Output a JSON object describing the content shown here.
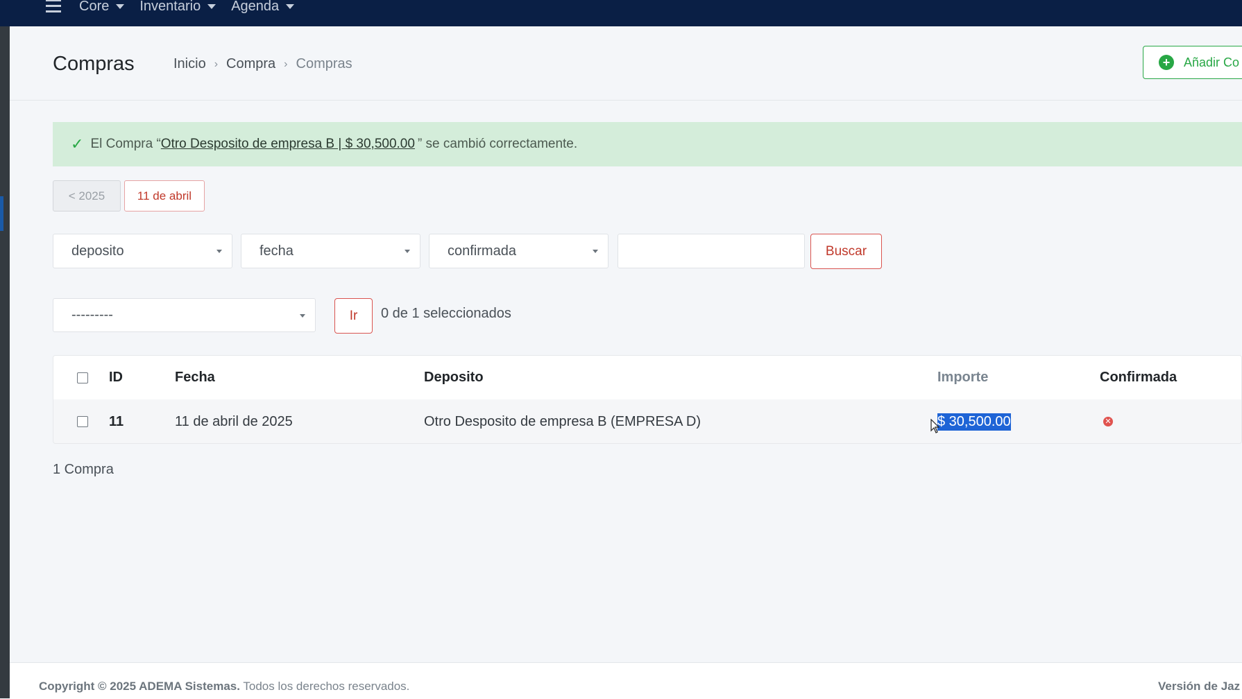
{
  "nav": {
    "items": [
      {
        "label": "Core"
      },
      {
        "label": "Inventario"
      },
      {
        "label": "Agenda"
      }
    ]
  },
  "header": {
    "title": "Compras",
    "breadcrumb": [
      "Inicio",
      "Compra",
      "Compras"
    ],
    "add_button_label": "Añadir Co"
  },
  "alert": {
    "prefix": "El Compra “",
    "link_text": "Otro Desposito de empresa B | $ 30,500.00",
    "suffix": "” se cambió correctamente."
  },
  "date_nav": {
    "prev_label": "< 2025",
    "current_label": "11 de abril"
  },
  "filters": {
    "deposito": "deposito",
    "fecha": "fecha",
    "confirmada": "confirmada",
    "search_value": "",
    "search_button": "Buscar"
  },
  "actions": {
    "selected_action": "---------",
    "go_button": "Ir",
    "selected_count": "0 de 1 seleccionados"
  },
  "table": {
    "columns": [
      "ID",
      "Fecha",
      "Deposito",
      "Importe",
      "Confirmada"
    ],
    "rows": [
      {
        "id": "11",
        "fecha": "11 de abril de 2025",
        "deposito": "Otro Desposito de empresa B (EMPRESA D)",
        "importe": "$ 30,500.00",
        "confirmada_icon": "x-circle-icon"
      }
    ]
  },
  "result_count": "1 Compra",
  "footer": {
    "copyright_bold": "Copyright © 2025 ADEMA Sistemas.",
    "copyright_rest": " Todos los derechos reservados.",
    "version_label": "Versión de Jaz"
  },
  "colors": {
    "topbar": "#0a1f45",
    "success": "#28a745",
    "danger": "#d9534f",
    "selection": "#1e64d6"
  }
}
